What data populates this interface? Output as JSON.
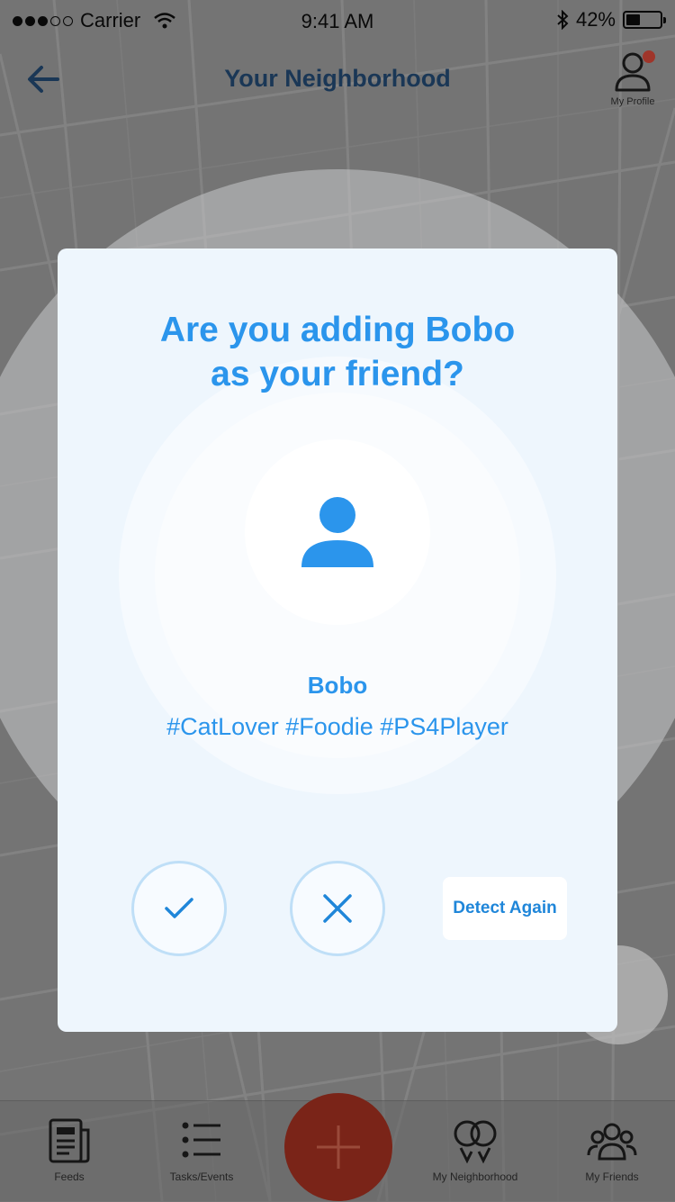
{
  "status_bar": {
    "carrier": "Carrier",
    "time": "9:41 AM",
    "battery_percent": "42%",
    "battery_level": 0.42
  },
  "nav": {
    "title": "Your Neighborhood",
    "back_icon": "arrow-left-icon",
    "profile_label": "My Profile",
    "profile_icon": "user-outline-icon"
  },
  "dialog": {
    "title_line1": "Are you adding Bobo",
    "title_line2": "as your friend?",
    "avatar_icon": "user-silhouette-icon",
    "friend_name": "Bobo",
    "friend_tags": "#CatLover #Foodie #PS4Player",
    "confirm_icon": "check-icon",
    "reject_icon": "close-icon",
    "detect_again_label": "Detect Again"
  },
  "tabs": [
    {
      "label": "Feeds",
      "icon": "newspaper-icon"
    },
    {
      "label": "Tasks/Events",
      "icon": "list-icon"
    },
    {
      "label": "My Neighborhood",
      "icon": "location-pins-icon"
    },
    {
      "label": "My Friends",
      "icon": "group-icon"
    }
  ],
  "fab_icon": "plus-icon",
  "colors": {
    "accent": "#2b95ec",
    "nav_title": "#173c63",
    "fab": "#7a2418",
    "notification": "#c0392b",
    "modal_bg": "#eef6fd"
  }
}
